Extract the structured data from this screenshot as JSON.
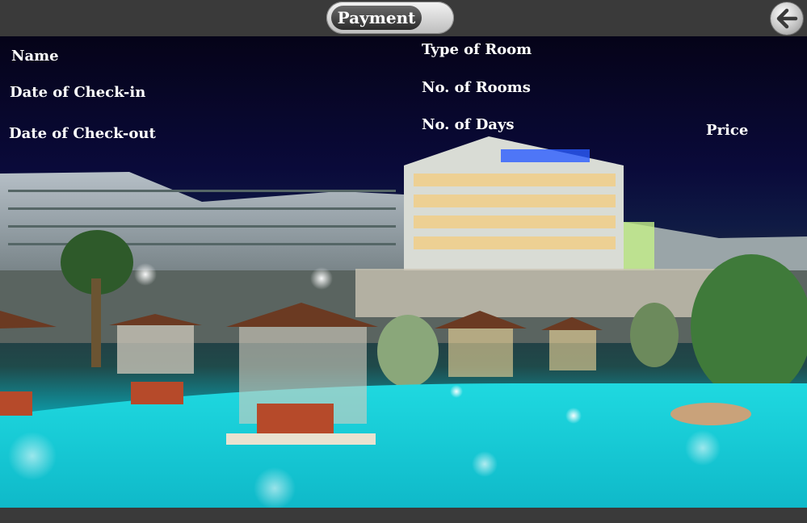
{
  "header": {
    "title": "Payment",
    "back_icon": "arrow-left-icon"
  },
  "form": {
    "name_label": "Name",
    "checkin_label": "Date of Check-in",
    "checkout_label": "Date of Check-out",
    "room_type_label": "Type of Room",
    "rooms_label": "No. of Rooms",
    "days_label": "No. of Days",
    "price_label": "Price"
  },
  "colors": {
    "bar": "#3a3a3a",
    "text": "#ffffff",
    "pool": "#10d4d8",
    "sky": "#050318"
  }
}
